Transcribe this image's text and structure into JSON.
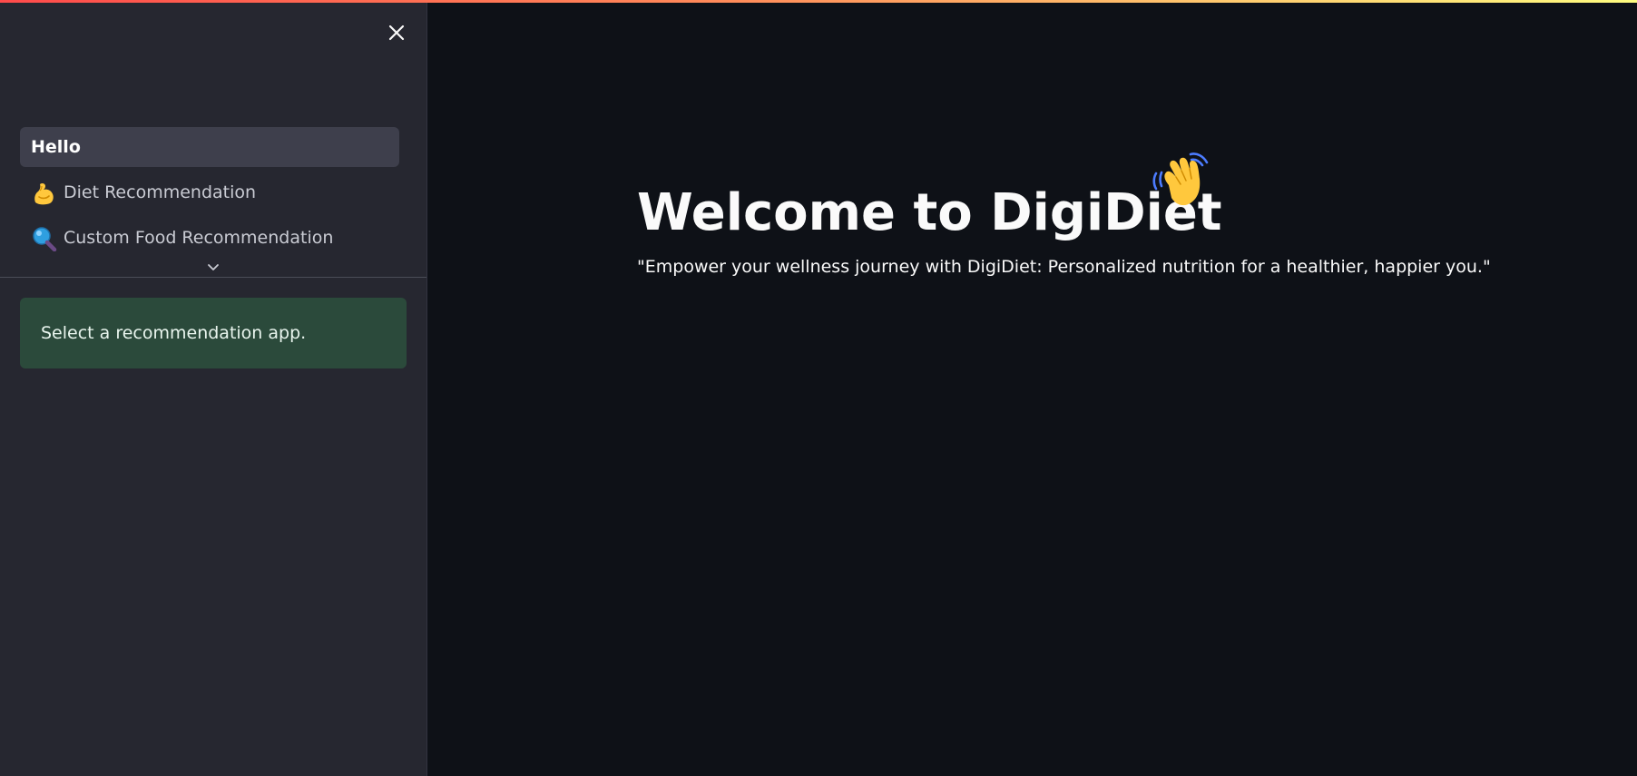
{
  "sidebar": {
    "close_icon": "close-icon",
    "nav": [
      {
        "label": "Hello",
        "icon": "",
        "active": true
      },
      {
        "label": "Diet Recommendation",
        "icon": "flexed-biceps-icon",
        "active": false
      },
      {
        "label": "Custom Food Recommendation",
        "icon": "magnifying-glass-icon",
        "active": false
      }
    ],
    "expand_icon": "chevron-down-icon",
    "info_message": "Select a recommendation app."
  },
  "main": {
    "title": "Welcome to DigiDiet",
    "title_icon": "waving-hand-icon",
    "subtitle": "\"Empower your wellness journey with DigiDiet: Personalized nutrition for a healthier, happier you.\""
  },
  "colors": {
    "background": "#0e1117",
    "sidebar": "#262730",
    "active_nav": "#3e3f4c",
    "success_box": "#2b4a3b",
    "accent_gradient_start": "#ff4b4b",
    "accent_gradient_end": "#fffd80"
  }
}
